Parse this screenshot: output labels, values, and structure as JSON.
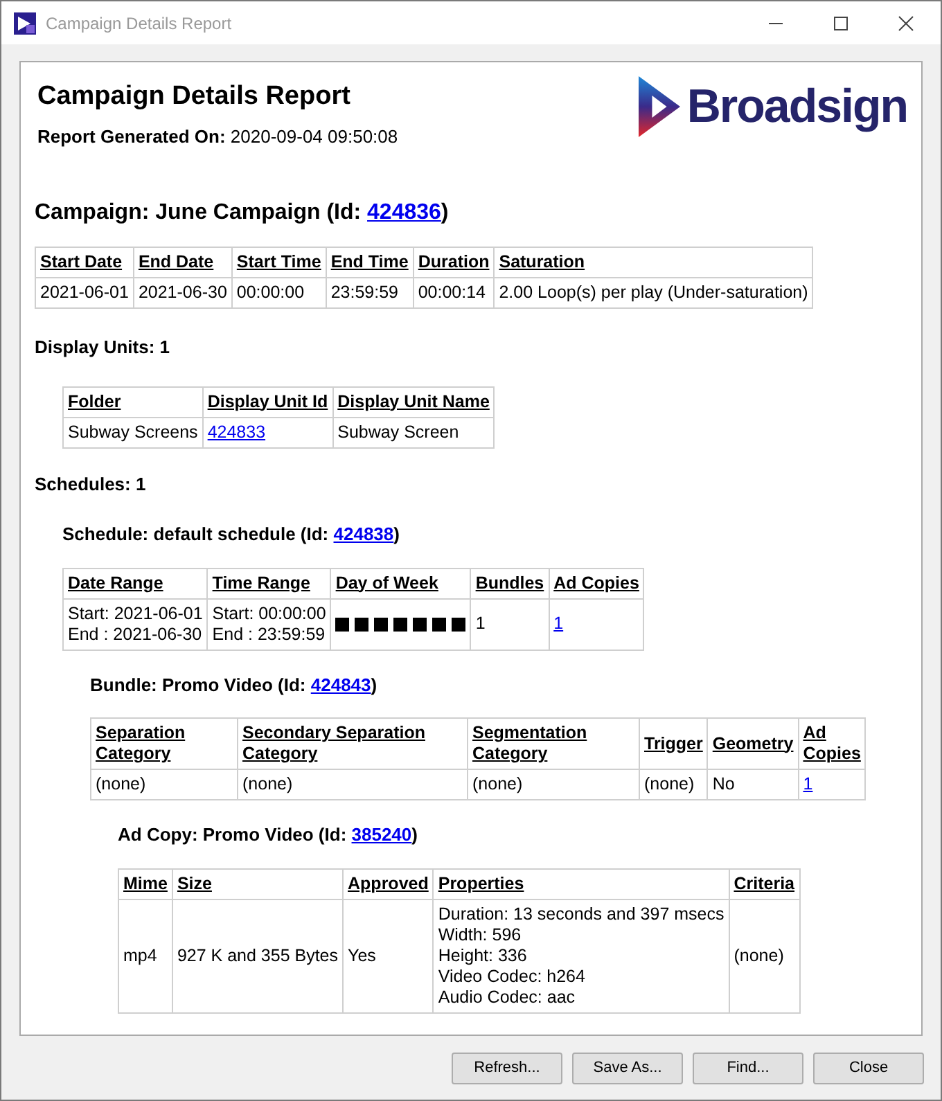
{
  "window": {
    "title": "Campaign Details Report"
  },
  "report": {
    "title": "Campaign Details Report",
    "logo": "Broadsign",
    "generated_label": "Report Generated On:",
    "generated_value": "2020-09-04 09:50:08",
    "campaign_heading": {
      "before": "Campaign: June Campaign (Id: ",
      "id": "424836",
      "after": ")"
    },
    "campaign_table": {
      "columns": [
        "Start Date",
        "End Date",
        "Start Time",
        "End Time",
        "Duration",
        "Saturation"
      ],
      "rows": [
        [
          "2021-06-01",
          "2021-06-30",
          "00:00:00",
          "23:59:59",
          "00:00:14",
          "2.00 Loop(s) per play (Under-saturation)"
        ]
      ]
    },
    "display_units_heading": "Display Units: 1",
    "display_units_table": {
      "columns": [
        "Folder",
        "Display Unit Id",
        "Display Unit Name"
      ],
      "rows": [
        [
          "Subway Screens",
          {
            "kind": "link",
            "text": "424833"
          },
          "Subway Screen"
        ]
      ]
    },
    "schedules_heading": "Schedules: 1",
    "schedule_heading": {
      "before": "Schedule: default schedule (Id: ",
      "id": "424838",
      "after": ")"
    },
    "schedule_table": {
      "columns": [
        "Date Range",
        "Time Range",
        "Day of Week",
        "Bundles",
        "Ad Copies"
      ],
      "rows": [
        [
          {
            "kind": "lines",
            "lines": [
              "Start: 2021-06-01",
              "End : 2021-06-30"
            ]
          },
          {
            "kind": "lines",
            "lines": [
              "Start: 00:00:00",
              "End : 23:59:59"
            ]
          },
          {
            "kind": "days",
            "days": [
              {
                "on": true
              },
              {
                "on": true
              },
              {
                "on": true
              },
              {
                "on": true
              },
              {
                "on": true
              },
              {
                "on": true
              },
              {
                "on": true
              }
            ]
          },
          "1",
          {
            "kind": "link",
            "text": "1"
          }
        ]
      ]
    },
    "bundle_heading": {
      "before": "Bundle: Promo Video (Id: ",
      "id": "424843",
      "after": ")"
    },
    "bundle_table": {
      "columns": [
        "Separation Category",
        "Secondary Separation Category",
        "Segmentation Category",
        "Trigger",
        "Geometry",
        "Ad Copies"
      ],
      "rows": [
        [
          "(none)",
          "(none)",
          "(none)",
          "(none)",
          "No",
          {
            "kind": "link",
            "text": "1"
          }
        ]
      ]
    },
    "ad_copy_heading": {
      "before": "Ad Copy: Promo Video (Id: ",
      "id": "385240",
      "after": ")"
    },
    "ad_copy_table": {
      "columns": [
        "Mime",
        "Size",
        "Approved",
        "Properties",
        "Criteria"
      ],
      "rows": [
        [
          "mp4",
          "927 K and 355 Bytes",
          "Yes",
          {
            "kind": "lines",
            "lines": [
              "Duration: 13 seconds and 397 msecs",
              "Width: 596",
              "Height: 336",
              "Video Codec: h264",
              "Audio Codec: aac"
            ]
          },
          "(none)"
        ]
      ]
    }
  },
  "buttons": [
    "Refresh...",
    "Save As...",
    "Find...",
    "Close"
  ]
}
